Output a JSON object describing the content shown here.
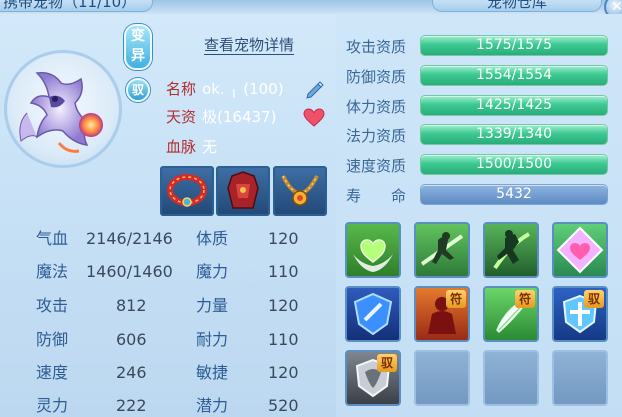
{
  "window": {
    "left_title": "携带宠物（11/10）",
    "right_title": "宠物仓库",
    "close_icon": "close-icon"
  },
  "pet": {
    "badge_mutate": "变异",
    "badge_tame": "驭",
    "detail_link": "查看宠物详情",
    "name_label": "名称",
    "name_value": "ok.  ╷  (100)",
    "talent_label": "天资",
    "talent_value": "极(16437)",
    "bloodline_label": "血脉",
    "bloodline_value": "无"
  },
  "stats": [
    {
      "label": "气血",
      "value": "2146/2146"
    },
    {
      "label": "体质",
      "value": "120"
    },
    {
      "label": "魔法",
      "value": "1460/1460"
    },
    {
      "label": "魔力",
      "value": "110"
    },
    {
      "label": "攻击",
      "value": "812"
    },
    {
      "label": "力量",
      "value": "120"
    },
    {
      "label": "防御",
      "value": "606"
    },
    {
      "label": "耐力",
      "value": "110"
    },
    {
      "label": "速度",
      "value": "246"
    },
    {
      "label": "敏捷",
      "value": "120"
    },
    {
      "label": "灵力",
      "value": "222"
    },
    {
      "label": "潜力",
      "value": "520"
    }
  ],
  "aptitudes": [
    {
      "label": "攻击资质",
      "value": "1575/1575",
      "fill": 1.0
    },
    {
      "label": "防御资质",
      "value": "1554/1554",
      "fill": 1.0
    },
    {
      "label": "体力资质",
      "value": "1425/1425",
      "fill": 1.0
    },
    {
      "label": "法力资质",
      "value": "1339/1340",
      "fill": 1.0
    },
    {
      "label": "速度资质",
      "value": "1500/1500",
      "fill": 1.0
    },
    {
      "label": "寿　　命",
      "value": "5432"
    }
  ],
  "skills": {
    "tags": [
      "符",
      "符",
      "驭",
      "驭"
    ]
  }
}
